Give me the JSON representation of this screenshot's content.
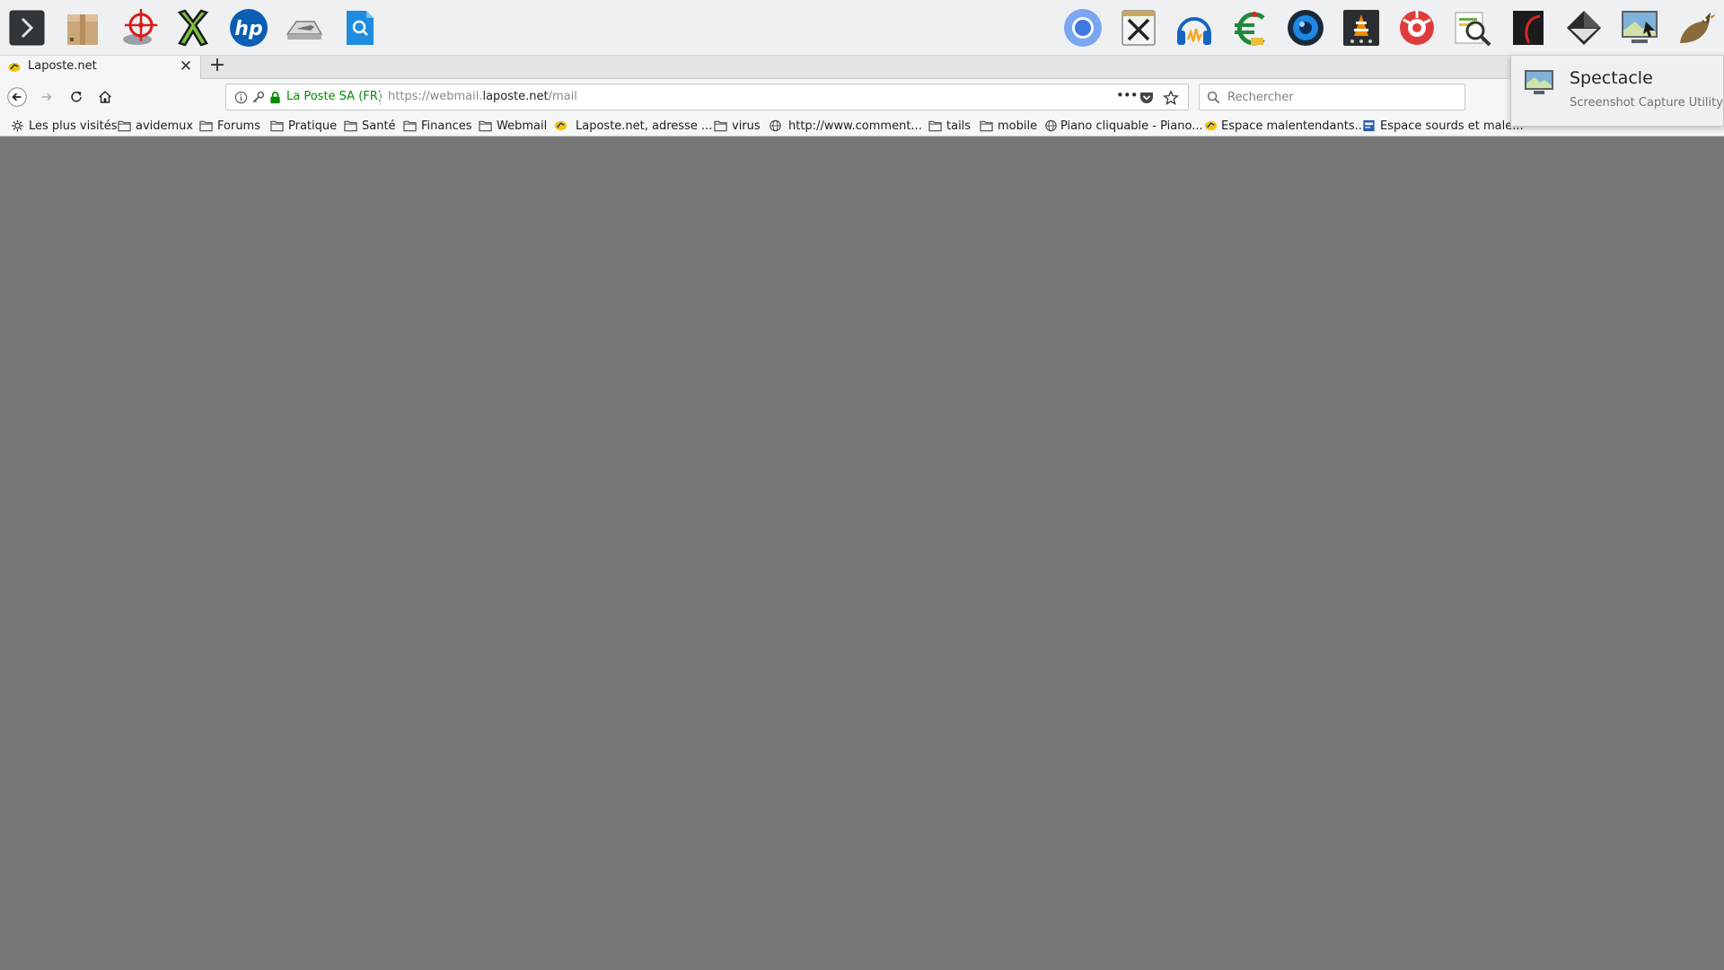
{
  "dock": {
    "launchers_left": [
      {
        "name": "konsole",
        "icon": "terminal-icon"
      },
      {
        "name": "ark",
        "icon": "package-icon"
      },
      {
        "name": "kruler",
        "icon": "target-icon"
      },
      {
        "name": "xchat",
        "icon": "x-icon"
      },
      {
        "name": "hplip",
        "icon": "hp-icon"
      },
      {
        "name": "system-settings",
        "icon": "wrench-icon"
      },
      {
        "name": "kfind",
        "icon": "file-search-icon"
      }
    ],
    "launchers_right": [
      {
        "name": "chromium",
        "icon": "chromium-icon"
      },
      {
        "name": "kate",
        "icon": "notepad-icon"
      },
      {
        "name": "audacity",
        "icon": "headphones-icon"
      },
      {
        "name": "kmymoney",
        "icon": "euro-icon"
      },
      {
        "name": "kamoso",
        "icon": "camera-icon"
      },
      {
        "name": "vlc",
        "icon": "vlc-cone-icon"
      },
      {
        "name": "kmines",
        "icon": "mines-icon"
      },
      {
        "name": "okular",
        "icon": "magnifier-doc-icon"
      },
      {
        "name": "calligra",
        "icon": "swoosh-icon"
      },
      {
        "name": "inkscape",
        "icon": "ink-drop-icon"
      },
      {
        "name": "spectacle",
        "icon": "screenshot-icon"
      },
      {
        "name": "kmail",
        "icon": "bird-icon"
      }
    ]
  },
  "tab": {
    "title": "Laposte.net",
    "close": "✕",
    "new_tab": "+"
  },
  "urlbar": {
    "identity": "La Poste SA (FR)",
    "url_prefix": "https://webmail.",
    "url_domain": "laposte.net",
    "url_suffix": "/mail",
    "page_actions": "•••"
  },
  "search": {
    "placeholder": "Rechercher"
  },
  "bookmarks": [
    {
      "label": "Les plus visités",
      "icon": "gear-icon"
    },
    {
      "label": "avidemux",
      "icon": "folder-icon"
    },
    {
      "label": "Forums",
      "icon": "folder-icon"
    },
    {
      "label": "Pratique",
      "icon": "folder-icon"
    },
    {
      "label": "Santé",
      "icon": "folder-icon"
    },
    {
      "label": "Finances",
      "icon": "folder-icon"
    },
    {
      "label": "Webmail",
      "icon": "folder-icon"
    },
    {
      "label": "Laposte.net, adresse ...",
      "icon": "laposte-icon"
    },
    {
      "label": "virus",
      "icon": "folder-icon"
    },
    {
      "label": "http://www.comment...",
      "icon": "globe-icon"
    },
    {
      "label": "tails",
      "icon": "folder-icon"
    },
    {
      "label": "mobile",
      "icon": "folder-icon"
    },
    {
      "label": "Piano cliquable - Piano...",
      "icon": "globe-icon"
    },
    {
      "label": "Espace malentendants...",
      "icon": "laposte-icon"
    },
    {
      "label": "Espace sourds et male...",
      "icon": "blue-page-icon"
    }
  ],
  "tooltip": {
    "title": "Spectacle",
    "subtitle": "Screenshot Capture Utility"
  },
  "colors": {
    "content_bg": "#767676",
    "identity_green": "#058b00",
    "toolbar_bg": "#f5f6f7",
    "dock_bg": "#eff0f1"
  }
}
